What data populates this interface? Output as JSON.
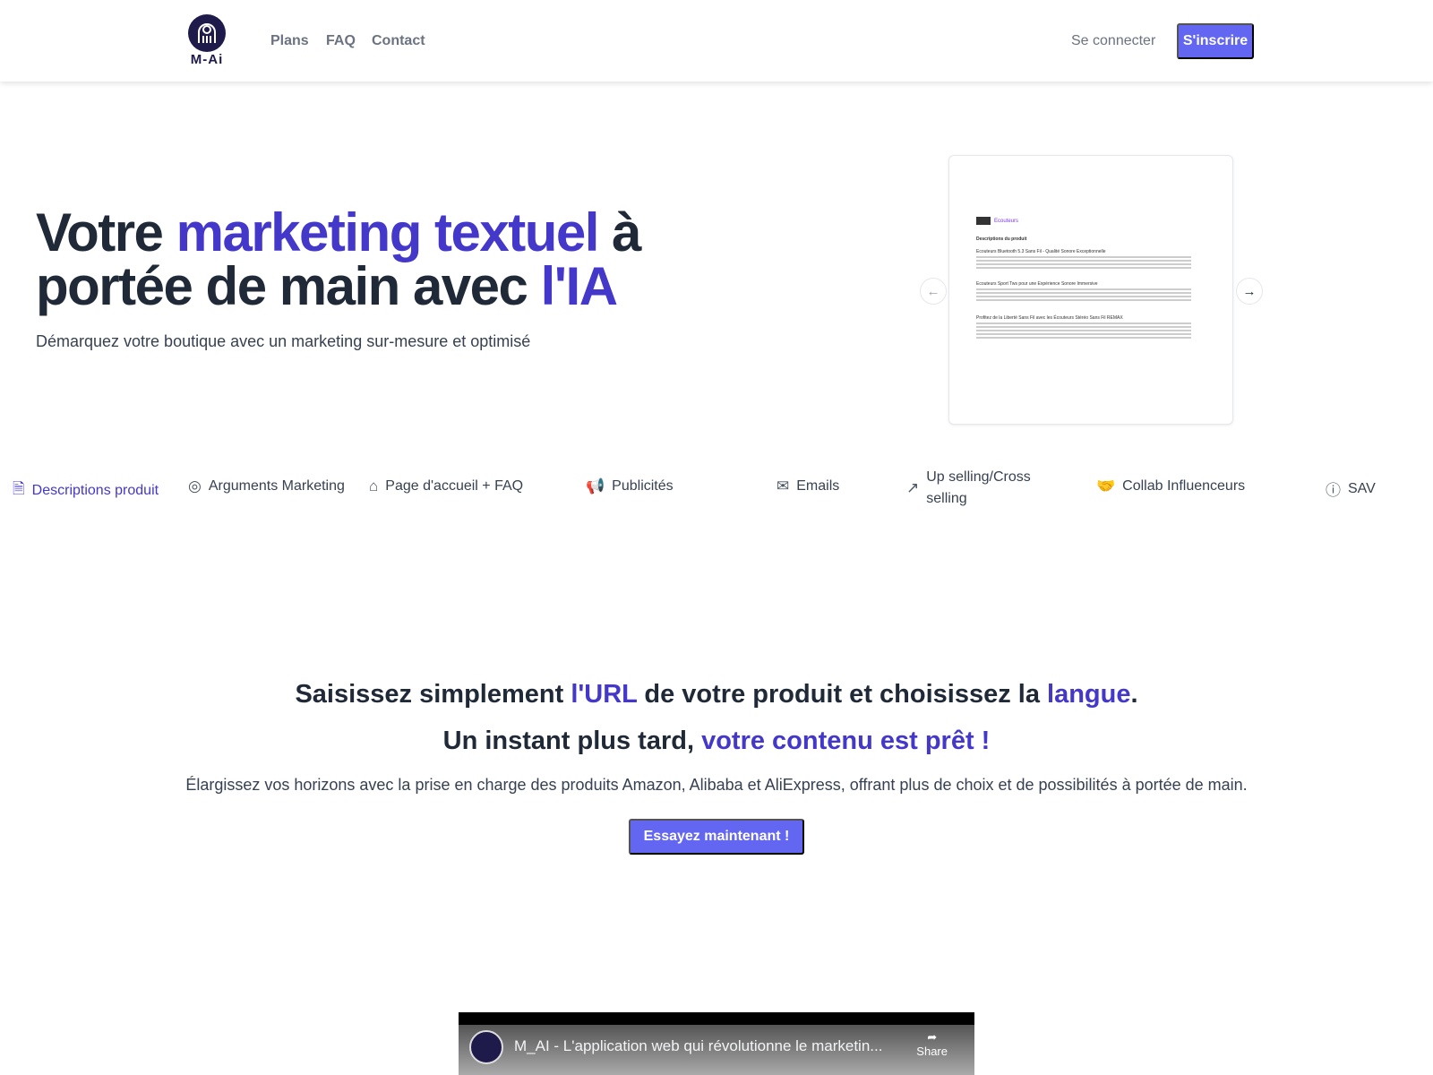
{
  "nav": {
    "logo_text": "M-Ai",
    "links": [
      "Plans",
      "FAQ",
      "Contact"
    ],
    "login": "Se connecter",
    "signup": "S'inscrire"
  },
  "hero": {
    "title_1": "Votre ",
    "title_accent_1": "marketing textuel",
    "title_2": " à portée de main avec ",
    "title_accent_2": "l'IA",
    "subtitle": "Démarquez votre boutique avec un marketing sur-mesure et optimisé",
    "preview": {
      "category": "Ecouteurs",
      "section": "Descriptions du produit",
      "items": [
        "Ecouteurs Bluetooth 5.3 Sans Fil - Qualité Sonore Exceptionnelle",
        "Ecouteurs Sport Tws pour une Expérience Sonore Immersive",
        "Profitez de la Liberté Sans Fil avec les Écouteurs Stéréo Sans Fil REMAX"
      ]
    }
  },
  "tabs": [
    {
      "label": "Descriptions produit",
      "icon": "document-icon"
    },
    {
      "label": "Arguments Marketing",
      "icon": "target-icon"
    },
    {
      "label": "Page d'accueil + FAQ",
      "icon": "home-icon"
    },
    {
      "label": "Publicités",
      "icon": "megaphone-icon"
    },
    {
      "label": "Emails",
      "icon": "mail-icon"
    },
    {
      "label": "Up selling/Cross selling",
      "icon": "trending-up-icon"
    },
    {
      "label": "Collab Influenceurs",
      "icon": "handshake-icon"
    },
    {
      "label": "SAV",
      "icon": "help-circle-icon"
    }
  ],
  "section": {
    "l1_a": "Saisissez simplement ",
    "l1_b": "l'URL",
    "l1_c": " de votre produit et choisissez la ",
    "l1_d": "langue",
    "l1_e": ".",
    "l2_a": "Un instant plus tard, ",
    "l2_b": "votre contenu est prêt !",
    "description": "Élargissez vos horizons avec la prise en charge des produits Amazon, Alibaba et AliExpress, offrant plus de choix et de possibilités à portée de main.",
    "cta": "Essayez maintenant !"
  },
  "video": {
    "title": "M_AI - L'application web qui révolutionne le marketin...",
    "share": "Share"
  },
  "colors": {
    "accent": "#4338ca",
    "button": "#6366f1",
    "text": "#1f2937"
  }
}
